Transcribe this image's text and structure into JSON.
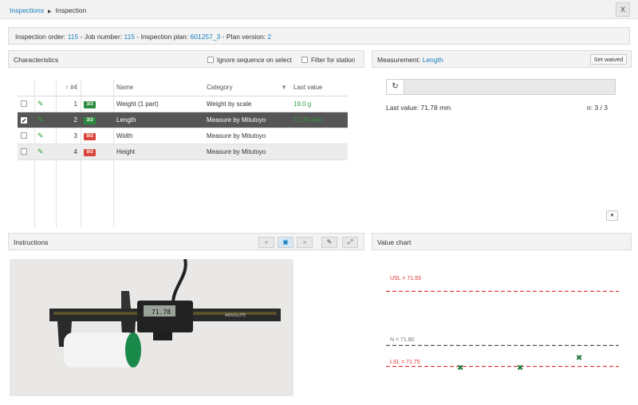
{
  "breadcrumb": {
    "root": "Inspections",
    "current": "Inspection"
  },
  "close_label": "X",
  "info": {
    "order_label": "Inspection order:",
    "order_value": "115",
    "job_label": "- Job number:",
    "job_value": "115",
    "plan_label": "- Inspection plan:",
    "plan_value": "601257_3",
    "version_label": "- Plan version:",
    "version_value": "2"
  },
  "characteristics": {
    "title": "Characteristics",
    "ignore_sequence_label": "Ignore sequence on select",
    "filter_station_label": "Filter for station",
    "headers": {
      "sort_arrow": "↑",
      "num": "#4",
      "name": "Name",
      "category": "Category",
      "last_value": "Last value"
    },
    "rows": [
      {
        "num": "1",
        "badge": "3/3",
        "badge_color": "#2a8a3e",
        "name": "Weight (1 part)",
        "category": "Weight by scale",
        "last_value": "19.0 g",
        "checked": false
      },
      {
        "num": "2",
        "badge": "3/3",
        "badge_color": "#2a8a3e",
        "name": "Length",
        "category": "Measure by Mitutoyo",
        "last_value": "71.78 mm",
        "checked": true
      },
      {
        "num": "3",
        "badge": "0/3",
        "badge_color": "#d9453a",
        "name": "Width",
        "category": "Measure by Mitutoyo",
        "last_value": "",
        "checked": false
      },
      {
        "num": "4",
        "badge": "0/3",
        "badge_color": "#d9453a",
        "name": "Height",
        "category": "Measure by Mitutoyo",
        "last_value": "",
        "checked": false
      }
    ]
  },
  "measurement": {
    "label": "Measurement:",
    "name": "Length",
    "set_waived": "Set waived",
    "refresh_icon": "refresh-icon",
    "last_value": "Last value: 71.78 mm",
    "count": "n: 3 / 3",
    "dropdown_icon": "chevron-down-icon"
  },
  "instructions": {
    "title": "Instructions",
    "prev": "«",
    "next": "»",
    "image_icon": "image-icon",
    "pin_icon": "pin-icon",
    "expand_icon": "expand-icon",
    "caliper_display": "71.78",
    "caliper_brand": "ABSOLUTE"
  },
  "value_chart": {
    "title": "Value chart",
    "accent_usl": "#e03030",
    "accent_nominal": "#555555",
    "marker_color": "#1e7a3a"
  },
  "chart_data": {
    "type": "scatter",
    "usl": 71.93,
    "nominal": 71.8,
    "lsl": 71.75,
    "usl_label": "USL = 71.93",
    "nominal_label": "N = 71.80",
    "lsl_label": "LSL = 71.75",
    "x": [
      1,
      2,
      3
    ],
    "y": [
      71.75,
      71.75,
      71.77
    ],
    "ylim": [
      71.73,
      71.95
    ]
  }
}
